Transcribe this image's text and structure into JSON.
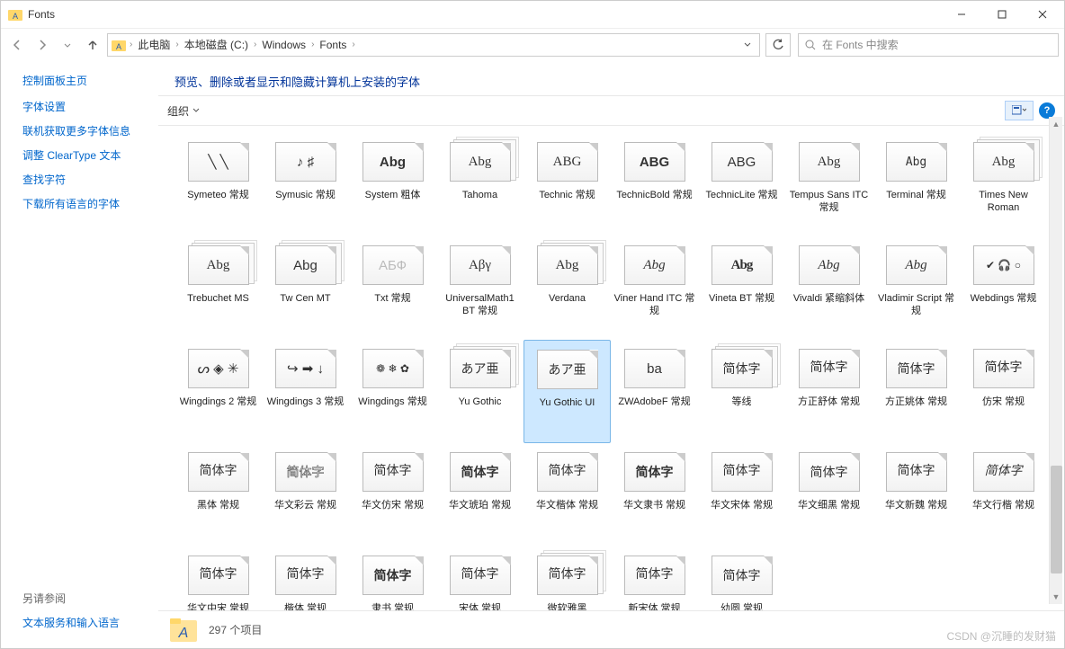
{
  "titlebar": {
    "title": "Fonts"
  },
  "breadcrumb": {
    "items": [
      "此电脑",
      "本地磁盘 (C:)",
      "Windows",
      "Fonts"
    ]
  },
  "search": {
    "placeholder": "在 Fonts 中搜索"
  },
  "sidebar": {
    "header": "控制面板主页",
    "links": [
      "字体设置",
      "联机获取更多字体信息",
      "调整 ClearType 文本",
      "查找字符",
      "下载所有语言的字体"
    ],
    "footer_header": "另请参阅",
    "footer_links": [
      "文本服务和输入语言"
    ]
  },
  "heading": "预览、删除或者显示和隐藏计算机上安装的字体",
  "toolbar": {
    "organize": "组织"
  },
  "fonts": [
    {
      "label": "Symeteo 常规",
      "sample": "╲ ╲",
      "stack": false,
      "style": ""
    },
    {
      "label": "Symusic 常规",
      "sample": "♪ ♯",
      "stack": false,
      "style": ""
    },
    {
      "label": "System 粗体",
      "sample": "Abg",
      "stack": false,
      "style": "font-weight:bold"
    },
    {
      "label": "Tahoma",
      "sample": "Abg",
      "stack": true,
      "style": "font-family:Tahoma"
    },
    {
      "label": "Technic 常规",
      "sample": "ABG",
      "stack": false,
      "style": "font-family:serif"
    },
    {
      "label": "TechnicBold 常规",
      "sample": "ABG",
      "stack": false,
      "style": "font-weight:bold"
    },
    {
      "label": "TechnicLite 常规",
      "sample": "ABG",
      "stack": false,
      "style": "font-weight:300"
    },
    {
      "label": "Tempus Sans ITC 常规",
      "sample": "Abg",
      "stack": false,
      "style": "font-family:cursive"
    },
    {
      "label": "Terminal 常规",
      "sample": "Abg",
      "stack": false,
      "style": "font-family:monospace;font-size:13px"
    },
    {
      "label": "Times New Roman",
      "sample": "Abg",
      "stack": true,
      "style": "font-family:'Times New Roman'"
    },
    {
      "label": "Trebuchet MS",
      "sample": "Abg",
      "stack": true,
      "style": "font-family:'Trebuchet MS'"
    },
    {
      "label": "Tw Cen MT",
      "sample": "Abg",
      "stack": true,
      "style": ""
    },
    {
      "label": "Txt 常规",
      "sample": "АБФ",
      "stack": false,
      "style": "color:#bbb"
    },
    {
      "label": "UniversalMath1 BT 常规",
      "sample": "Αβγ",
      "stack": false,
      "style": "font-family:serif"
    },
    {
      "label": "Verdana",
      "sample": "Abg",
      "stack": true,
      "style": "font-family:Verdana"
    },
    {
      "label": "Viner Hand ITC 常规",
      "sample": "Abg",
      "stack": false,
      "style": "font-style:italic;font-family:cursive"
    },
    {
      "label": "Vineta BT 常规",
      "sample": "Abg",
      "stack": false,
      "style": "font-weight:900;font-family:serif;letter-spacing:-1px"
    },
    {
      "label": "Vivaldi 紧缩斜体",
      "sample": "Abg",
      "stack": false,
      "style": "font-style:italic;font-family:cursive"
    },
    {
      "label": "Vladimir Script 常规",
      "sample": "Abg",
      "stack": false,
      "style": "font-style:italic;font-family:cursive"
    },
    {
      "label": "Webdings 常规",
      "sample": "✔ 🎧 ○",
      "stack": false,
      "style": "font-size:12px"
    },
    {
      "label": "Wingdings 2 常规",
      "sample": "ᔕ ◈ ✳",
      "stack": false,
      "style": ""
    },
    {
      "label": "Wingdings 3 常规",
      "sample": "↪ ➡ ↓",
      "stack": false,
      "style": ""
    },
    {
      "label": "Wingdings 常规",
      "sample": "❁ ❄ ✿",
      "stack": false,
      "style": "font-size:12px"
    },
    {
      "label": "Yu Gothic",
      "sample": "あア亜",
      "stack": true,
      "style": "font-size:14px"
    },
    {
      "label": "Yu Gothic UI",
      "sample": "あア亜",
      "stack": true,
      "style": "font-size:14px",
      "selected": true
    },
    {
      "label": "ZWAdobeF 常规",
      "sample": "ba",
      "stack": false,
      "style": ""
    },
    {
      "label": "等线",
      "sample": "简体字",
      "stack": true,
      "style": "font-size:14px"
    },
    {
      "label": "方正舒体 常规",
      "sample": "简体字",
      "stack": false,
      "style": "font-family:cursive;font-size:14px"
    },
    {
      "label": "方正姚体 常规",
      "sample": "简体字",
      "stack": false,
      "style": "font-size:14px"
    },
    {
      "label": "仿宋 常规",
      "sample": "简体字",
      "stack": false,
      "style": "font-family:FangSong;font-size:14px"
    },
    {
      "label": "黑体 常规",
      "sample": "简体字",
      "stack": false,
      "style": "font-family:SimHei;font-size:14px"
    },
    {
      "label": "华文彩云 常规",
      "sample": "简体字",
      "stack": false,
      "style": "-webkit-text-stroke:0.6px #555;color:#fff;font-size:14px"
    },
    {
      "label": "华文仿宋 常规",
      "sample": "简体字",
      "stack": false,
      "style": "font-family:FangSong;font-size:14px"
    },
    {
      "label": "华文琥珀 常规",
      "sample": "简体字",
      "stack": false,
      "style": "font-weight:900;font-size:14px"
    },
    {
      "label": "华文楷体 常规",
      "sample": "简体字",
      "stack": false,
      "style": "font-family:KaiTi;font-size:14px"
    },
    {
      "label": "华文隶书 常规",
      "sample": "简体字",
      "stack": false,
      "style": "font-weight:bold;font-size:14px"
    },
    {
      "label": "华文宋体 常规",
      "sample": "简体字",
      "stack": false,
      "style": "font-family:SimSun;font-size:14px"
    },
    {
      "label": "华文细黑 常规",
      "sample": "简体字",
      "stack": false,
      "style": "font-weight:300;font-size:14px"
    },
    {
      "label": "华文新魏 常规",
      "sample": "简体字",
      "stack": false,
      "style": "font-family:cursive;font-size:14px"
    },
    {
      "label": "华文行楷 常规",
      "sample": "简体字",
      "stack": false,
      "style": "font-style:italic;font-family:cursive;font-size:14px"
    },
    {
      "label": "华文中宋 常规",
      "sample": "简体字",
      "stack": false,
      "style": "font-family:SimSun;font-size:14px"
    },
    {
      "label": "楷体 常规",
      "sample": "简体字",
      "stack": false,
      "style": "font-family:KaiTi;font-size:14px"
    },
    {
      "label": "隶书 常规",
      "sample": "简体字",
      "stack": false,
      "style": "font-weight:bold;font-size:14px"
    },
    {
      "label": "宋体 常规",
      "sample": "简体字",
      "stack": false,
      "style": "font-family:SimSun;font-size:14px"
    },
    {
      "label": "微软雅黑",
      "sample": "简体字",
      "stack": true,
      "style": "font-family:'Microsoft YaHei';font-size:14px"
    },
    {
      "label": "新宋体 常规",
      "sample": "简体字",
      "stack": false,
      "style": "font-family:NSimSun;font-size:14px"
    },
    {
      "label": "幼圆 常规",
      "sample": "简体字",
      "stack": false,
      "style": "font-size:14px"
    }
  ],
  "status": {
    "count": "297 个项目"
  },
  "watermark": "CSDN @沉睡的发财猫"
}
